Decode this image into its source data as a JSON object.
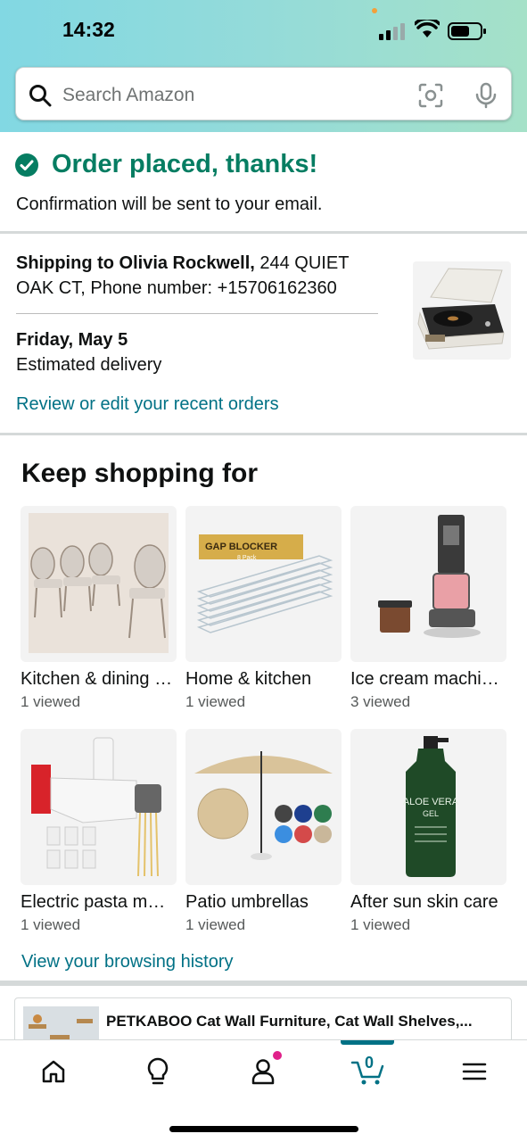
{
  "status_bar": {
    "time": "14:32"
  },
  "search": {
    "placeholder": "Search Amazon"
  },
  "order": {
    "title": "Order placed, thanks!",
    "subtitle": "Confirmation will be sent to your email."
  },
  "shipping": {
    "label": "Shipping to Olivia Rockwell,",
    "address": " 244 QUIET OAK CT, Phone number: +15706162360",
    "delivery_date": "Friday, May 5",
    "delivery_label": "Estimated delivery",
    "review_link": "Review or edit your recent orders"
  },
  "keep_shopping": {
    "title": "Keep shopping for",
    "items": [
      {
        "title": "Kitchen & dining …",
        "meta": "1 viewed"
      },
      {
        "title": "Home & kitchen",
        "meta": "1 viewed"
      },
      {
        "title": "Ice cream machi…",
        "meta": "3 viewed"
      },
      {
        "title": "Electric pasta m…",
        "meta": "1 viewed"
      },
      {
        "title": "Patio umbrellas",
        "meta": "1 viewed"
      },
      {
        "title": "After sun skin care",
        "meta": "1 viewed"
      }
    ],
    "history_link": "View your browsing history",
    "gap_blocker_label": "GAP BLOCKER",
    "gap_blocker_sub": "8 Pack",
    "aloe_brand": "ALOE VERA",
    "aloe_sub": "GEL"
  },
  "recommendation": {
    "title": "PETKABOO Cat Wall Furniture, Cat Wall Shelves,..."
  },
  "nav": {
    "cart_count": "0",
    "items": [
      "home-icon",
      "lightbulb-icon",
      "account-icon",
      "cart-icon",
      "menu-icon"
    ]
  },
  "colors": {
    "accent_green": "#067d62",
    "link": "#007185",
    "notification": "#e0218a"
  }
}
